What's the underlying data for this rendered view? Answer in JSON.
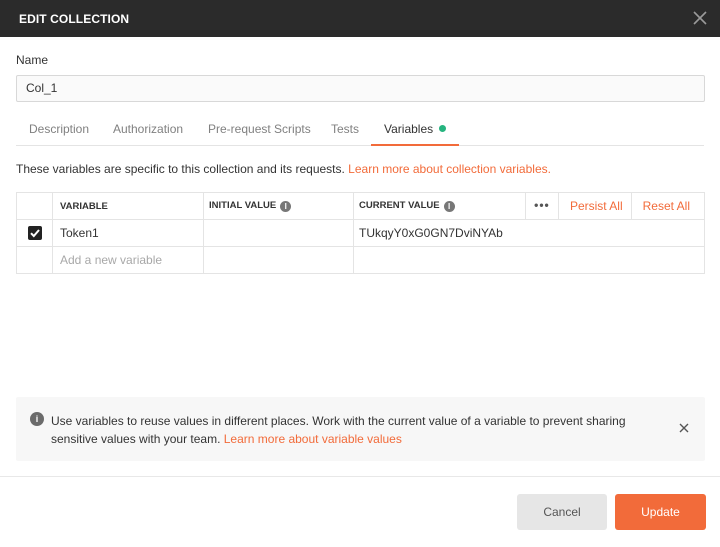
{
  "dialog": {
    "title": "EDIT COLLECTION"
  },
  "name_field": {
    "label": "Name",
    "value": "Col_1"
  },
  "tabs": [
    {
      "label": "Description"
    },
    {
      "label": "Authorization"
    },
    {
      "label": "Pre-request Scripts"
    },
    {
      "label": "Tests"
    },
    {
      "label": "Variables",
      "active": true,
      "indicator_color": "#26b47f"
    }
  ],
  "variables_panel": {
    "intro_text": "These variables are specific to this collection and its requests. ",
    "intro_link": "Learn more about collection variables."
  },
  "table": {
    "headers": {
      "variable": "VARIABLE",
      "initial_value": "INITIAL VALUE",
      "current_value": "CURRENT VALUE"
    },
    "more_label": "•••",
    "persist_all": "Persist All",
    "reset_all": "Reset All",
    "rows": [
      {
        "checked": true,
        "variable": "Token1",
        "initial_value": "",
        "current_value": "TUkqyY0xG0GN7DviNYAb"
      }
    ],
    "new_row_placeholder": "Add a new variable"
  },
  "notice": {
    "text": "Use variables to reuse values in different places. Work with the current value of a variable to prevent sharing sensitive values with your team. ",
    "link": "Learn more about variable values"
  },
  "buttons": {
    "cancel": "Cancel",
    "update": "Update"
  },
  "colors": {
    "accent": "#f26b3a",
    "titlebar": "#2b2b2b",
    "success": "#26b47f"
  }
}
